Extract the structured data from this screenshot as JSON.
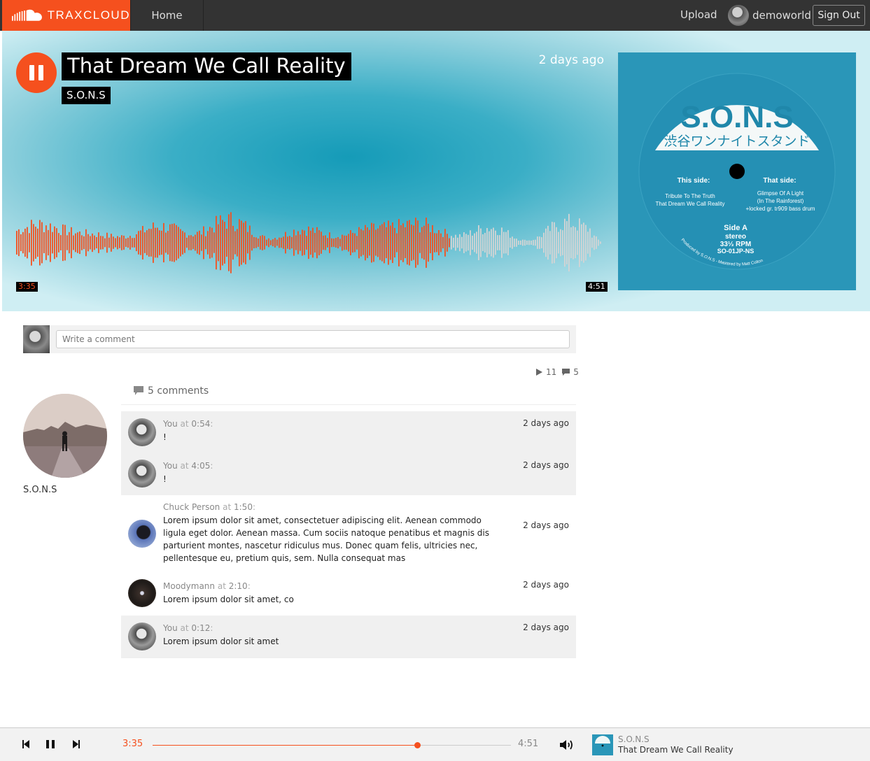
{
  "nav": {
    "logo": "TRAXCLOUD",
    "home": "Home",
    "upload": "Upload",
    "username": "demoworld",
    "signout": "Sign Out"
  },
  "track": {
    "title": "That Dream We Call Reality",
    "artist": "S.O.N.S",
    "date": "2 days ago",
    "current_time": "3:35",
    "duration": "4:51",
    "progress": 0.738
  },
  "cover": {
    "brand": "S.O.N.S",
    "subtitle": "渋谷ワンナイトスタンド",
    "this_side_label": "This side:",
    "this_side_tracks": [
      "Tribute To The Truth",
      "That Dream We Call Reality"
    ],
    "that_side_label": "That side:",
    "that_side_tracks": [
      "Glimpse Of A Light",
      "(In The Rainforest)",
      "+locked gr. tr909 bass drum"
    ],
    "side": "Side A",
    "stereo": "stereo",
    "rpm": "33⅓ RPM",
    "catalog": "SO-01JP-NS",
    "credits": "Produced by S.O.N.S - Mastered by Matt Colton"
  },
  "comment_input": {
    "placeholder": "Write a comment"
  },
  "stats": {
    "plays": "11",
    "comments": "5"
  },
  "artist_panel": {
    "name": "S.O.N.S"
  },
  "comments_header": "5 comments",
  "comments": [
    {
      "user": "You",
      "at": "at",
      "time": "0:54",
      "text": "!",
      "date": "2 days ago",
      "highlight": true,
      "avatar": "robot"
    },
    {
      "user": "You",
      "at": "at",
      "time": "4:05",
      "text": "!",
      "date": "2 days ago",
      "highlight": true,
      "avatar": "robot"
    },
    {
      "user": "Chuck Person",
      "at": "at",
      "time": "1:50",
      "text": "Lorem ipsum dolor sit amet, consectetuer adipiscing elit. Aenean commodo ligula eget dolor. Aenean massa. Cum sociis natoque penatibus et magnis dis parturient montes, nascetur ridiculus mus. Donec quam felis, ultricies nec, pellentesque eu, pretium quis, sem. Nulla consequat mas",
      "date": "2 days ago",
      "highlight": false,
      "avatar": "blue"
    },
    {
      "user": "Moodymann",
      "at": "at",
      "time": "2:10",
      "text": "Lorem ipsum dolor sit amet, co",
      "date": "2 days ago",
      "highlight": false,
      "avatar": "dark"
    },
    {
      "user": "You",
      "at": "at",
      "time": "0:12",
      "text": "Lorem ipsum dolor sit amet",
      "date": "2 days ago",
      "highlight": true,
      "avatar": "robot"
    }
  ],
  "player": {
    "current_time": "3:35",
    "duration": "4:51",
    "mini_artist": "S.O.N.S",
    "mini_title": "That Dream We Call Reality"
  },
  "colors": {
    "accent": "#f5501e",
    "navbar": "#333333",
    "cover": "#2a96b8",
    "waveform_unplayed": "#d4d4d4"
  }
}
